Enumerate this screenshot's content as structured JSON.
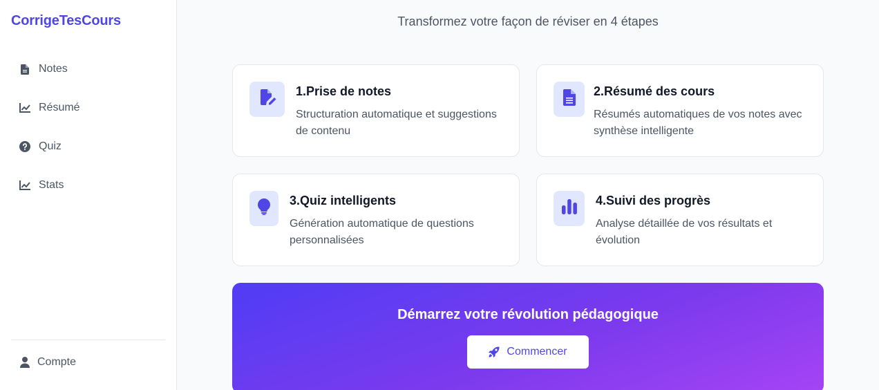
{
  "app": {
    "title": "CorrigeTesCours"
  },
  "colors": {
    "accent": "#4f46e5",
    "icon_bg": "#e0e7ff",
    "gradient_start": "#4f3df5",
    "gradient_end": "#a544f5"
  },
  "sidebar": {
    "items": [
      {
        "label": "Notes",
        "icon": "file-icon"
      },
      {
        "label": "Résumé",
        "icon": "chart-line-icon"
      },
      {
        "label": "Quiz",
        "icon": "question-circle-icon"
      },
      {
        "label": "Stats",
        "icon": "chart-line-icon"
      }
    ],
    "account": {
      "label": "Compte",
      "icon": "user-icon"
    }
  },
  "main": {
    "subtitle": "Transformez votre façon de réviser en 4 étapes",
    "steps": [
      {
        "title": "1.Prise de notes",
        "description": "Structuration automatique et suggestions de contenu",
        "icon": "file-edit-icon"
      },
      {
        "title": "2.Résumé des cours",
        "description": "Résumés automatiques de vos notes avec synthèse intelligente",
        "icon": "document-icon"
      },
      {
        "title": "3.Quiz intelligents",
        "description": "Génération automatique de questions personnalisées",
        "icon": "lightbulb-icon"
      },
      {
        "title": "4.Suivi des progrès",
        "description": "Analyse détaillée de vos résultats et évolution",
        "icon": "bar-chart-icon"
      }
    ],
    "cta": {
      "title": "Démarrez votre révolution pédagogique",
      "button_label": "Commencer",
      "button_icon": "rocket-icon"
    }
  }
}
